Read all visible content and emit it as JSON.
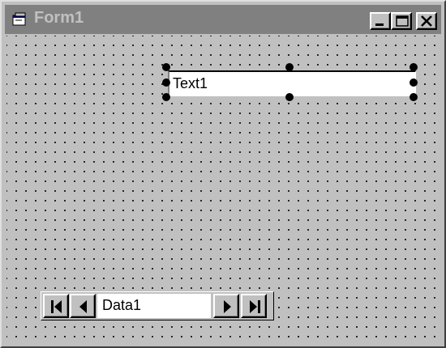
{
  "window": {
    "title": "Form1",
    "icon": "form-icon",
    "controls": [
      "minimize-icon",
      "maximize-icon",
      "close-icon"
    ]
  },
  "textbox": {
    "text": "Text1",
    "selected": true
  },
  "data_control": {
    "caption": "Data1",
    "buttons": [
      "first-record-icon",
      "previous-record-icon",
      "next-record-icon",
      "last-record-icon"
    ]
  }
}
